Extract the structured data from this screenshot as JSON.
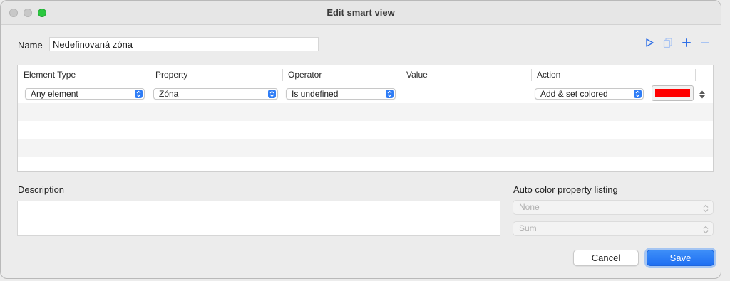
{
  "window": {
    "title": "Edit smart view"
  },
  "name": {
    "label": "Name",
    "value": "Nedefinovaná zóna"
  },
  "toolbar": {
    "icons": [
      "play-icon",
      "copy-icon",
      "plus-icon",
      "minus-icon"
    ],
    "accent_color": "#2f6fe6"
  },
  "table": {
    "headers": [
      "Element Type",
      "Property",
      "Operator",
      "Value",
      "Action"
    ],
    "rows": [
      {
        "element_type": "Any element",
        "property": "Zóna",
        "operator": "Is undefined",
        "value": "",
        "action": "Add & set colored",
        "color": "#ff0000"
      }
    ]
  },
  "description": {
    "label": "Description",
    "value": ""
  },
  "auto_color": {
    "label": "Auto color property listing",
    "select1": "None",
    "select2": "Sum"
  },
  "buttons": {
    "cancel": "Cancel",
    "save": "Save"
  }
}
